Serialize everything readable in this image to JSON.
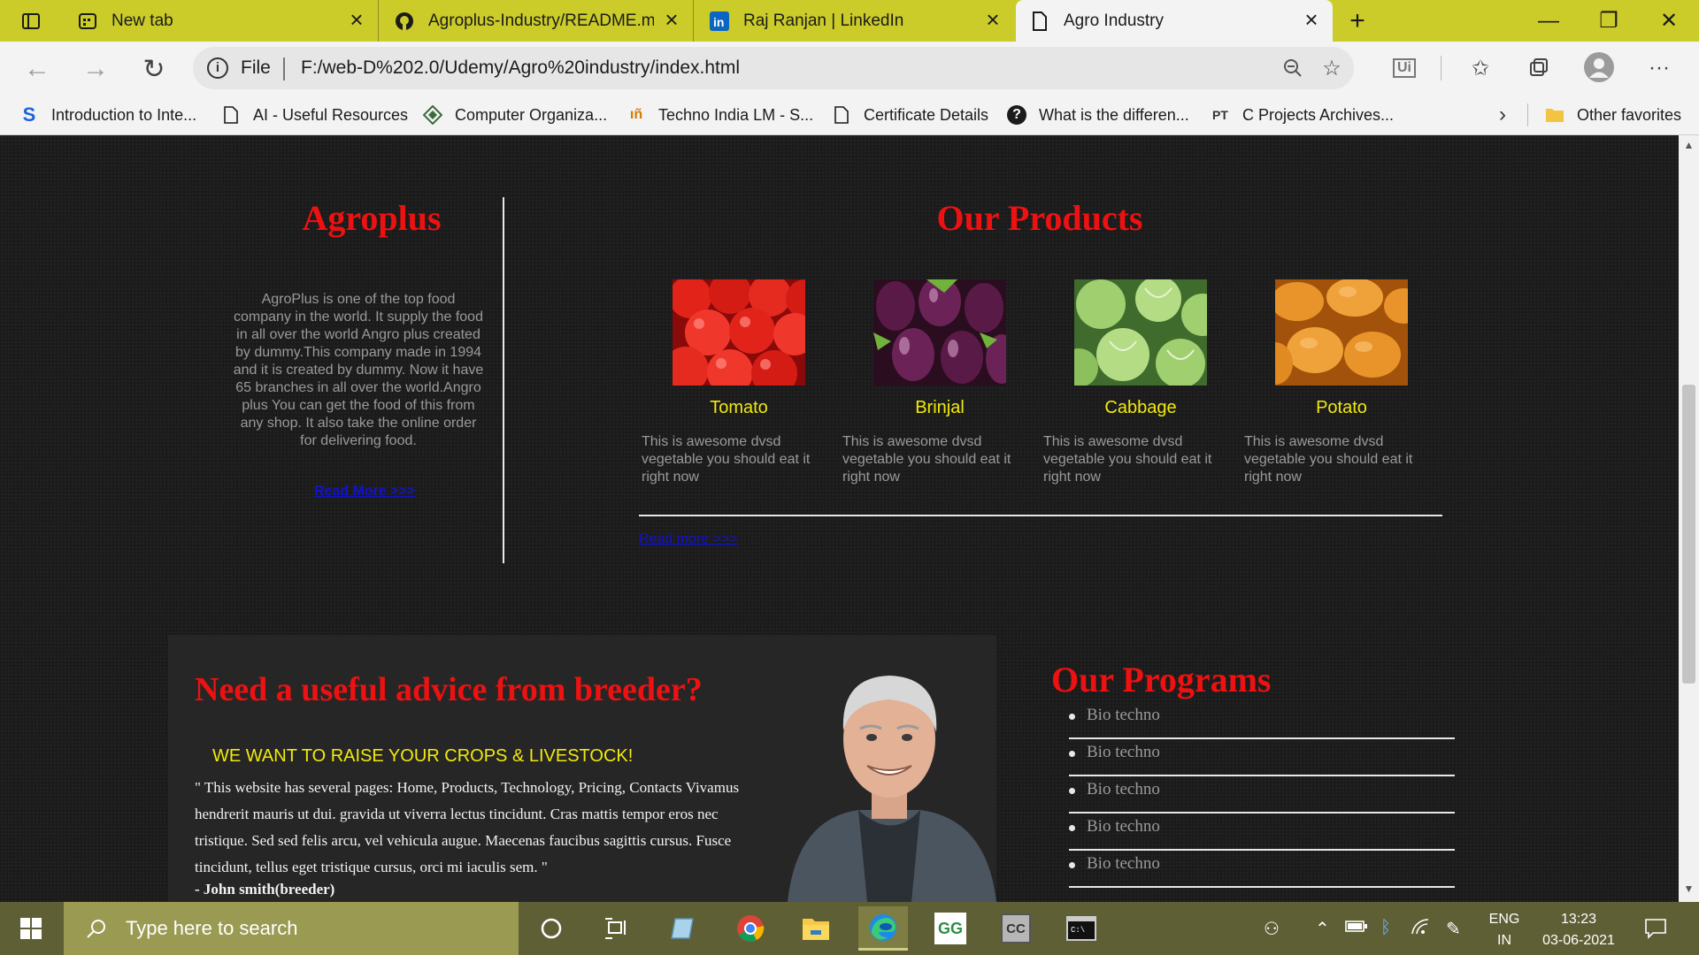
{
  "browser": {
    "tabs": [
      {
        "title": "New tab",
        "icon": "new-tab-icon"
      },
      {
        "title": "Agroplus-Industry/README.md a",
        "icon": "github-icon"
      },
      {
        "title": "Raj Ranjan | LinkedIn",
        "icon": "linkedin-icon"
      },
      {
        "title": "Agro Industry",
        "icon": "file-icon",
        "active": true
      }
    ],
    "address": {
      "scheme": "File",
      "url": "F:/web-D%202.0/Udemy/Agro%20industry/index.html"
    },
    "favorites": [
      {
        "label": "Introduction to Inte...",
        "icon": "s-logo-icon"
      },
      {
        "label": "AI - Useful Resources",
        "icon": "file-icon"
      },
      {
        "label": "Computer Organiza...",
        "icon": "diamond-icon"
      },
      {
        "label": "Techno India LM - S...",
        "icon": "techno-icon"
      },
      {
        "label": "Certificate Details",
        "icon": "file-icon"
      },
      {
        "label": "What is the differen...",
        "icon": "question-icon"
      },
      {
        "label": "C Projects Archives...",
        "icon": "pt-icon"
      }
    ],
    "other_favorites": "Other favorites",
    "pt_badge": "PT",
    "ui_badge": "Ui"
  },
  "page": {
    "about": {
      "title": "Agroplus",
      "text": "AgroPlus is one of the top food company in the world. It supply the food in all over the world Angro plus created by dummy.This company made in 1994 and it is created by dummy. Now it have 65 branches in all over the world.Angro plus You can get the food of this from any shop. It also take the online order for delivering food.",
      "link": "Read More >>>"
    },
    "products": {
      "title": "Our Products",
      "items": [
        {
          "name": "Tomato",
          "desc": "This is awesome dvsd vegetable you should eat it right now"
        },
        {
          "name": "Brinjal",
          "desc": "This is awesome dvsd vegetable you should eat it right now"
        },
        {
          "name": "Cabbage",
          "desc": "This is awesome dvsd vegetable you should eat it right now"
        },
        {
          "name": "Potato",
          "desc": "This is awesome dvsd vegetable you should eat it right now"
        }
      ],
      "link": "Read more >>>"
    },
    "advice": {
      "title": "Need a useful advice from breeder?",
      "subtitle": "WE WANT TO RAISE YOUR CROPS & LIVESTOCK!",
      "quote": "\" This website has several pages: Home, Products, Technology, Pricing, Contacts Vivamus hendrerit mauris ut dui. gravida ut viverra lectus tincidunt. Cras mattis tempor eros nec tristique. Sed sed felis arcu, vel vehicula augue. Maecenas faucibus sagittis cursus. Fusce tincidunt, tellus eget tristique cursus, orci mi iaculis sem. \"",
      "author": "- John smith(breeder)"
    },
    "programs": {
      "title": "Our Programs",
      "items": [
        "Bio techno",
        "Bio techno",
        "Bio techno",
        "Bio techno",
        "Bio techno"
      ]
    }
  },
  "taskbar": {
    "search_placeholder": "Type here to search",
    "gfg_label": "GG",
    "cc_label": "CC",
    "lang_top": "ENG",
    "lang_bottom": "IN",
    "time": "13:23",
    "date": "03-06-2021"
  },
  "colors": {
    "tabbar": "#cbcb2a",
    "heading_red": "#ee1111",
    "product_yellow": "#f2ea0c",
    "link_blue": "#1212cc",
    "taskbar": "#5f5f36"
  }
}
